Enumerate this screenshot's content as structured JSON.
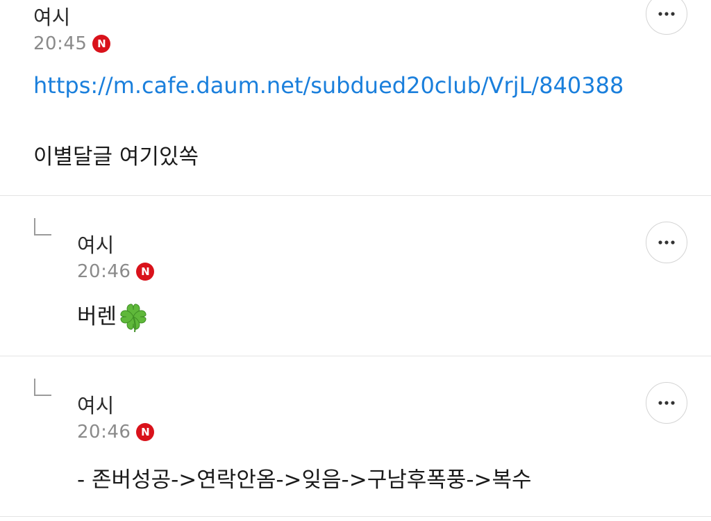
{
  "comments": [
    {
      "author": "여시",
      "time": "20:45",
      "badge": "N",
      "link": "https://m.cafe.daum.net/subdued20club/VrjL/840388",
      "text": "이별달글 여기있쏙",
      "more_label": "더보기"
    },
    {
      "author": "여시",
      "time": "20:46",
      "badge": "N",
      "text": "버렌",
      "emoji": "four-leaf-clover",
      "more_label": "더보기"
    },
    {
      "author": "여시",
      "time": "20:46",
      "badge": "N",
      "text": "- 존버성공->연락안옴->잊음->구남후폭풍->복수",
      "more_label": "더보기"
    }
  ],
  "colors": {
    "link": "#1a7fdc",
    "badge": "#d9121b",
    "timestamp": "#8a8a8a",
    "divider": "#e3e3e3"
  },
  "icons": {
    "more": "more-horizontal-icon",
    "reply": "reply-arrow-icon",
    "badge": "new-badge-icon"
  }
}
